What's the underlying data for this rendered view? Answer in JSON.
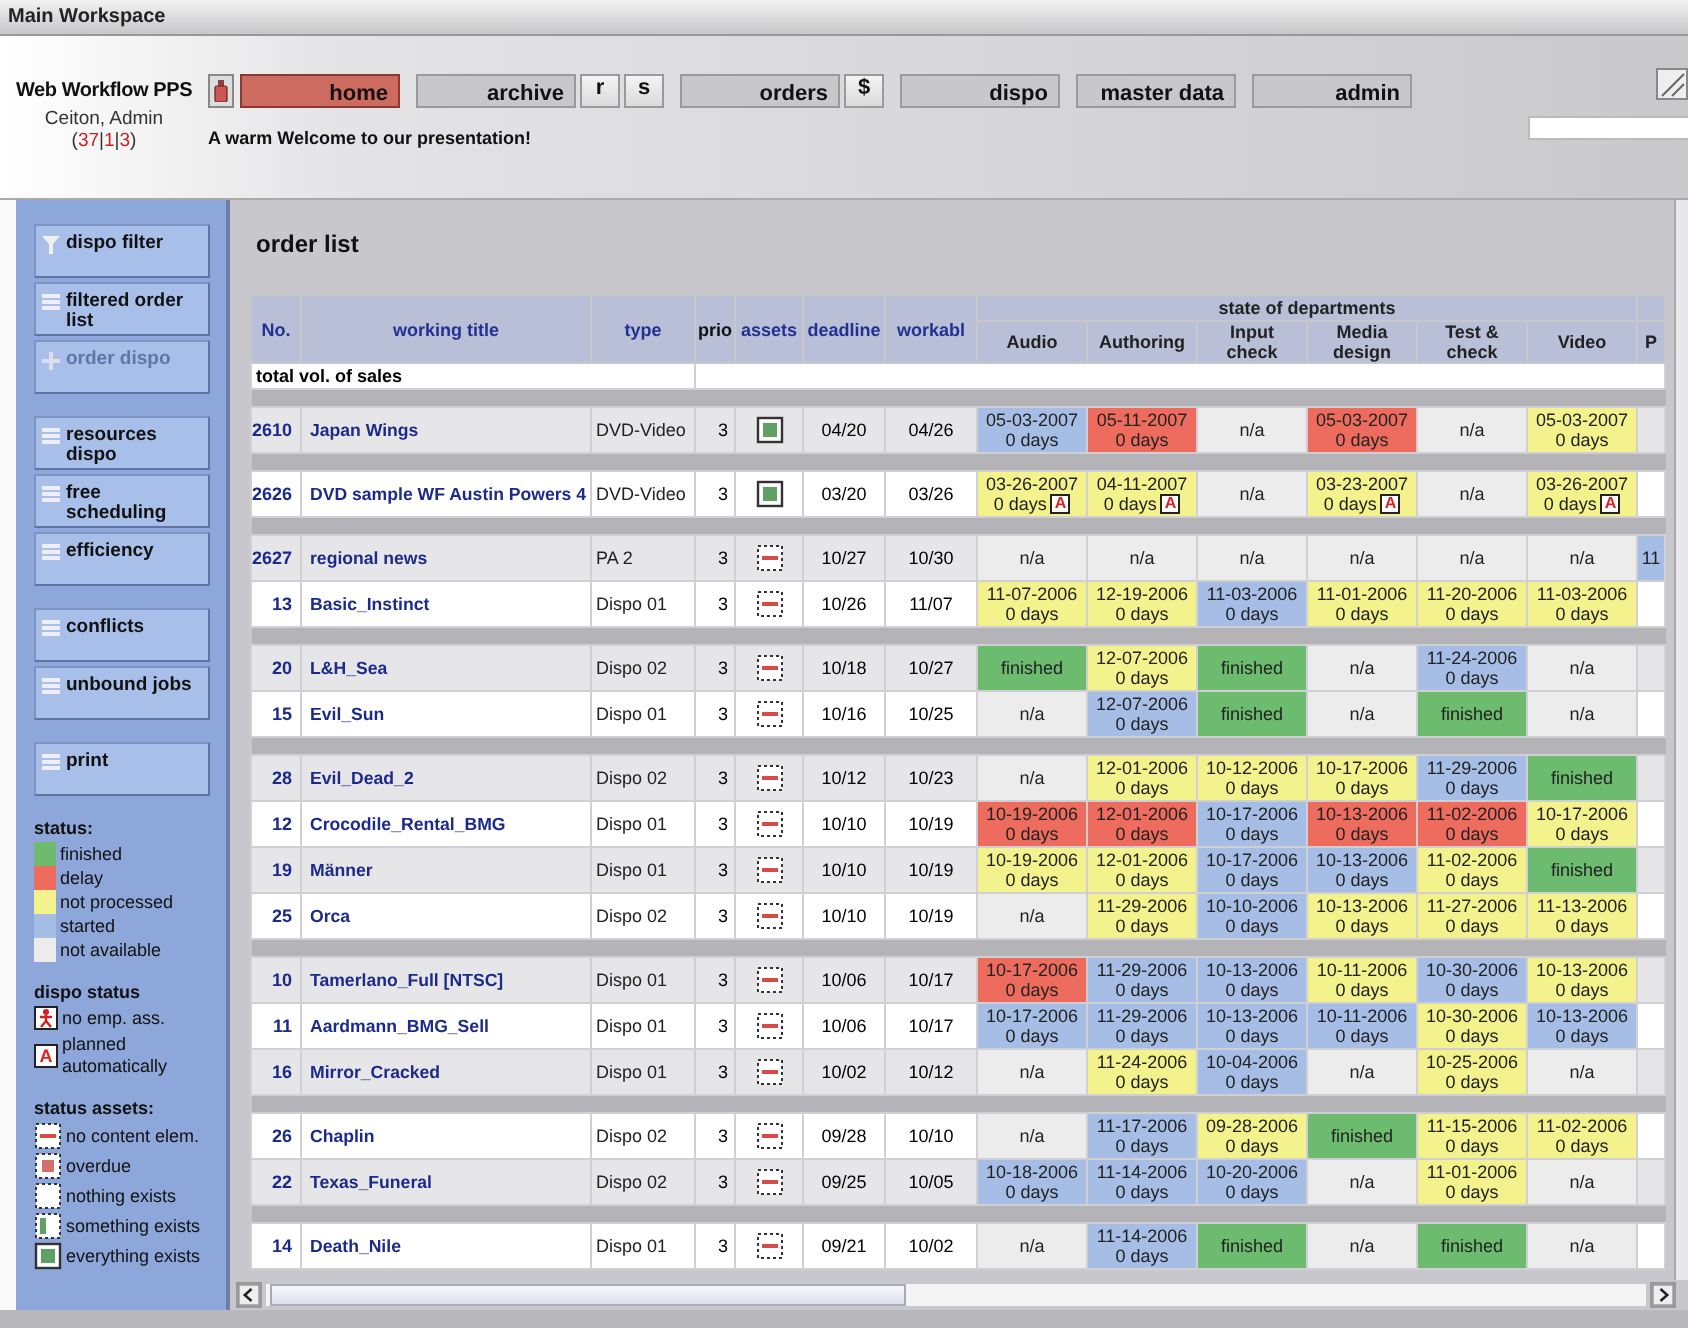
{
  "window": {
    "title": "Main Workspace"
  },
  "header": {
    "app_name": "Web Workflow PPS",
    "user": "Ceiton, Admin",
    "counts": [
      {
        "text": "(",
        "kind": "punct"
      },
      {
        "text": "37",
        "kind": "count"
      },
      {
        "text": "|",
        "kind": "punct"
      },
      {
        "text": "1",
        "kind": "count"
      },
      {
        "text": "|",
        "kind": "punct"
      },
      {
        "text": "3",
        "kind": "count"
      },
      {
        "text": ")",
        "kind": "punct"
      }
    ],
    "welcome": "A warm Welcome to our presentation!"
  },
  "nav": [
    {
      "label": "home",
      "selected": true
    },
    {
      "label": "archive",
      "selected": false,
      "extras": [
        "r",
        "s"
      ]
    },
    {
      "label": "orders",
      "selected": false,
      "extras": [
        "$"
      ]
    },
    {
      "label": "dispo",
      "selected": false
    },
    {
      "label": "master data",
      "selected": false
    },
    {
      "label": "admin",
      "selected": false
    }
  ],
  "sidebar": {
    "groups": [
      [
        {
          "label": "dispo filter",
          "kind": "filter",
          "disabled": false
        },
        {
          "label": "filtered order list",
          "kind": "list",
          "disabled": false
        },
        {
          "label": "order dispo",
          "kind": "plus",
          "disabled": true
        }
      ],
      [
        {
          "label": "resources dispo",
          "kind": "list",
          "disabled": false
        },
        {
          "label": "free scheduling",
          "kind": "list",
          "disabled": false
        },
        {
          "label": "efficiency",
          "kind": "list",
          "disabled": false
        }
      ],
      [
        {
          "label": "conflicts",
          "kind": "list",
          "disabled": false
        },
        {
          "label": "unbound jobs",
          "kind": "list",
          "disabled": false
        }
      ],
      [
        {
          "label": "print",
          "kind": "list",
          "disabled": false
        }
      ]
    ],
    "status_legend": {
      "title": "status:",
      "items": [
        {
          "label": "finished",
          "color": "#6cbb6e"
        },
        {
          "label": "delay",
          "color": "#ee6c5e"
        },
        {
          "label": "not processed",
          "color": "#f3f28c"
        },
        {
          "label": "started",
          "color": "#a6bee6"
        },
        {
          "label": "not available",
          "color": "#ececec"
        }
      ]
    },
    "dispo_legend": {
      "title": "dispo status",
      "items": [
        {
          "label": "no emp. ass.",
          "kind": "no_employee"
        },
        {
          "label": "planned automatically",
          "kind": "auto",
          "badge": "A"
        }
      ]
    },
    "assets_legend": {
      "title": "status assets:",
      "items": [
        {
          "label": "no content elem.",
          "kind": "no_content"
        },
        {
          "label": "overdue",
          "kind": "overdue"
        },
        {
          "label": "nothing exists",
          "kind": "nothing"
        },
        {
          "label": "something exists",
          "kind": "something"
        },
        {
          "label": "everything exists",
          "kind": "everything"
        }
      ]
    }
  },
  "order_list": {
    "title": "order list",
    "columns": [
      "No.",
      "working title",
      "type",
      "prio",
      "assets",
      "deadline",
      "workabl"
    ],
    "departments_title": "state of departments",
    "departments": [
      "Audio",
      "Authoring",
      "Input check",
      "Media design",
      "Test & check",
      "Video",
      "P"
    ],
    "total_label": "total vol. of sales",
    "groups": [
      [
        {
          "no": "2610",
          "title": "Japan Wings",
          "type": "DVD-Video",
          "prio": "3",
          "assets": {
            "kind": "everything"
          },
          "deadline": "04/20",
          "workable": "04/26",
          "cells": [
            {
              "color": "#a6bee6",
              "text": "05-03-2007",
              "days": "0 days"
            },
            {
              "color": "#ee6c5e",
              "text": "05-11-2007",
              "days": "0 days"
            },
            {
              "color": "#ececec",
              "text": "n/a"
            },
            {
              "color": "#ee6c5e",
              "text": "05-03-2007",
              "days": "0 days"
            },
            {
              "color": "#ececec",
              "text": "n/a"
            },
            {
              "color": "#f3f28c",
              "text": "05-03-2007",
              "days": "0 days"
            }
          ]
        }
      ],
      [
        {
          "no": "2626",
          "title": "DVD sample WF Austin Powers 4",
          "type": "DVD-Video",
          "prio": "3",
          "assets": {
            "kind": "everything"
          },
          "deadline": "03/20",
          "workable": "03/26",
          "cells": [
            {
              "color": "#f3f28c",
              "text": "03-26-2007",
              "days": "0 days",
              "badge": "A"
            },
            {
              "color": "#f3f28c",
              "text": "04-11-2007",
              "days": "0 days",
              "badge": "A"
            },
            {
              "color": "#ececec",
              "text": "n/a"
            },
            {
              "color": "#f3f28c",
              "text": "03-23-2007",
              "days": "0 days",
              "badge": "A"
            },
            {
              "color": "#ececec",
              "text": "n/a"
            },
            {
              "color": "#f3f28c",
              "text": "03-26-2007",
              "days": "0 days",
              "badge": "A"
            }
          ]
        }
      ],
      [
        {
          "no": "2627",
          "title": "regional news",
          "type": "PA 2",
          "prio": "3",
          "assets": {
            "kind": "no_content"
          },
          "deadline": "10/27",
          "workable": "10/30",
          "cells": [
            {
              "color": "#ececec",
              "text": "n/a"
            },
            {
              "color": "#ececec",
              "text": "n/a"
            },
            {
              "color": "#ececec",
              "text": "n/a"
            },
            {
              "color": "#ececec",
              "text": "n/a"
            },
            {
              "color": "#ececec",
              "text": "n/a"
            },
            {
              "color": "#ececec",
              "text": "n/a"
            },
            {
              "color": "#a6bee6",
              "text": "11"
            }
          ]
        },
        {
          "no": "13",
          "title": "Basic_Instinct",
          "type": "Dispo 01",
          "prio": "3",
          "assets": {
            "kind": "no_content"
          },
          "deadline": "10/26",
          "workable": "11/07",
          "cells": [
            {
              "color": "#f3f28c",
              "text": "11-07-2006",
              "days": "0 days"
            },
            {
              "color": "#f3f28c",
              "text": "12-19-2006",
              "days": "0 days"
            },
            {
              "color": "#a6bee6",
              "text": "11-03-2006",
              "days": "0 days"
            },
            {
              "color": "#f3f28c",
              "text": "11-01-2006",
              "days": "0 days"
            },
            {
              "color": "#f3f28c",
              "text": "11-20-2006",
              "days": "0 days"
            },
            {
              "color": "#f3f28c",
              "text": "11-03-2006",
              "days": "0 days"
            }
          ]
        }
      ],
      [
        {
          "no": "20",
          "title": "L&H_Sea",
          "type": "Dispo 02",
          "prio": "3",
          "assets": {
            "kind": "no_content"
          },
          "deadline": "10/18",
          "workable": "10/27",
          "cells": [
            {
              "color": "#6cbb6e",
              "text": "finished"
            },
            {
              "color": "#f3f28c",
              "text": "12-07-2006",
              "days": "0 days"
            },
            {
              "color": "#6cbb6e",
              "text": "finished"
            },
            {
              "color": "#ececec",
              "text": "n/a"
            },
            {
              "color": "#a6bee6",
              "text": "11-24-2006",
              "days": "0 days"
            },
            {
              "color": "#ececec",
              "text": "n/a"
            }
          ]
        },
        {
          "no": "15",
          "title": "Evil_Sun",
          "type": "Dispo 01",
          "prio": "3",
          "assets": {
            "kind": "no_content"
          },
          "deadline": "10/16",
          "workable": "10/25",
          "cells": [
            {
              "color": "#ececec",
              "text": "n/a"
            },
            {
              "color": "#a6bee6",
              "text": "12-07-2006",
              "days": "0 days"
            },
            {
              "color": "#6cbb6e",
              "text": "finished"
            },
            {
              "color": "#ececec",
              "text": "n/a"
            },
            {
              "color": "#6cbb6e",
              "text": "finished"
            },
            {
              "color": "#ececec",
              "text": "n/a"
            }
          ]
        }
      ],
      [
        {
          "no": "28",
          "title": "Evil_Dead_2",
          "type": "Dispo 02",
          "prio": "3",
          "assets": {
            "kind": "no_content"
          },
          "deadline": "10/12",
          "workable": "10/23",
          "cells": [
            {
              "color": "#ececec",
              "text": "n/a"
            },
            {
              "color": "#f3f28c",
              "text": "12-01-2006",
              "days": "0 days"
            },
            {
              "color": "#f3f28c",
              "text": "10-12-2006",
              "days": "0 days"
            },
            {
              "color": "#f3f28c",
              "text": "10-17-2006",
              "days": "0 days"
            },
            {
              "color": "#a6bee6",
              "text": "11-29-2006",
              "days": "0 days"
            },
            {
              "color": "#6cbb6e",
              "text": "finished"
            }
          ]
        },
        {
          "no": "12",
          "title": "Crocodile_Rental_BMG",
          "type": "Dispo 01",
          "prio": "3",
          "assets": {
            "kind": "no_content"
          },
          "deadline": "10/10",
          "workable": "10/19",
          "cells": [
            {
              "color": "#ee6c5e",
              "text": "10-19-2006",
              "days": "0 days"
            },
            {
              "color": "#ee6c5e",
              "text": "12-01-2006",
              "days": "0 days"
            },
            {
              "color": "#a6bee6",
              "text": "10-17-2006",
              "days": "0 days"
            },
            {
              "color": "#ee6c5e",
              "text": "10-13-2006",
              "days": "0 days"
            },
            {
              "color": "#ee6c5e",
              "text": "11-02-2006",
              "days": "0 days"
            },
            {
              "color": "#f3f28c",
              "text": "10-17-2006",
              "days": "0 days"
            }
          ]
        },
        {
          "no": "19",
          "title": "Männer",
          "type": "Dispo 01",
          "prio": "3",
          "assets": {
            "kind": "no_content"
          },
          "deadline": "10/10",
          "workable": "10/19",
          "cells": [
            {
              "color": "#f3f28c",
              "text": "10-19-2006",
              "days": "0 days"
            },
            {
              "color": "#f3f28c",
              "text": "12-01-2006",
              "days": "0 days"
            },
            {
              "color": "#a6bee6",
              "text": "10-17-2006",
              "days": "0 days"
            },
            {
              "color": "#a6bee6",
              "text": "10-13-2006",
              "days": "0 days"
            },
            {
              "color": "#f3f28c",
              "text": "11-02-2006",
              "days": "0 days"
            },
            {
              "color": "#6cbb6e",
              "text": "finished"
            }
          ]
        },
        {
          "no": "25",
          "title": "Orca",
          "type": "Dispo 02",
          "prio": "3",
          "assets": {
            "kind": "no_content"
          },
          "deadline": "10/10",
          "workable": "10/19",
          "cells": [
            {
              "color": "#ececec",
              "text": "n/a"
            },
            {
              "color": "#f3f28c",
              "text": "11-29-2006",
              "days": "0 days"
            },
            {
              "color": "#a6bee6",
              "text": "10-10-2006",
              "days": "0 days"
            },
            {
              "color": "#f3f28c",
              "text": "10-13-2006",
              "days": "0 days"
            },
            {
              "color": "#f3f28c",
              "text": "11-27-2006",
              "days": "0 days"
            },
            {
              "color": "#f3f28c",
              "text": "11-13-2006",
              "days": "0 days"
            }
          ]
        }
      ],
      [
        {
          "no": "10",
          "title": "Tamerlano_Full [NTSC]",
          "type": "Dispo 01",
          "prio": "3",
          "assets": {
            "kind": "no_content"
          },
          "deadline": "10/06",
          "workable": "10/17",
          "cells": [
            {
              "color": "#ee6c5e",
              "text": "10-17-2006",
              "days": "0 days"
            },
            {
              "color": "#a6bee6",
              "text": "11-29-2006",
              "days": "0 days"
            },
            {
              "color": "#a6bee6",
              "text": "10-13-2006",
              "days": "0 days"
            },
            {
              "color": "#f3f28c",
              "text": "10-11-2006",
              "days": "0 days"
            },
            {
              "color": "#a6bee6",
              "text": "10-30-2006",
              "days": "0 days"
            },
            {
              "color": "#f3f28c",
              "text": "10-13-2006",
              "days": "0 days"
            }
          ]
        },
        {
          "no": "11",
          "title": "Aardmann_BMG_Sell",
          "type": "Dispo 01",
          "prio": "3",
          "assets": {
            "kind": "no_content"
          },
          "deadline": "10/06",
          "workable": "10/17",
          "cells": [
            {
              "color": "#a6bee6",
              "text": "10-17-2006",
              "days": "0 days"
            },
            {
              "color": "#a6bee6",
              "text": "11-29-2006",
              "days": "0 days"
            },
            {
              "color": "#a6bee6",
              "text": "10-13-2006",
              "days": "0 days"
            },
            {
              "color": "#a6bee6",
              "text": "10-11-2006",
              "days": "0 days"
            },
            {
              "color": "#f3f28c",
              "text": "10-30-2006",
              "days": "0 days"
            },
            {
              "color": "#a6bee6",
              "text": "10-13-2006",
              "days": "0 days"
            }
          ]
        },
        {
          "no": "16",
          "title": "Mirror_Cracked",
          "type": "Dispo 01",
          "prio": "3",
          "assets": {
            "kind": "no_content"
          },
          "deadline": "10/02",
          "workable": "10/12",
          "cells": [
            {
              "color": "#ececec",
              "text": "n/a"
            },
            {
              "color": "#f3f28c",
              "text": "11-24-2006",
              "days": "0 days"
            },
            {
              "color": "#a6bee6",
              "text": "10-04-2006",
              "days": "0 days"
            },
            {
              "color": "#ececec",
              "text": "n/a"
            },
            {
              "color": "#f3f28c",
              "text": "10-25-2006",
              "days": "0 days"
            },
            {
              "color": "#ececec",
              "text": "n/a"
            }
          ]
        }
      ],
      [
        {
          "no": "26",
          "title": "Chaplin",
          "type": "Dispo 02",
          "prio": "3",
          "assets": {
            "kind": "no_content"
          },
          "deadline": "09/28",
          "workable": "10/10",
          "cells": [
            {
              "color": "#ececec",
              "text": "n/a"
            },
            {
              "color": "#a6bee6",
              "text": "11-17-2006",
              "days": "0 days"
            },
            {
              "color": "#f3f28c",
              "text": "09-28-2006",
              "days": "0 days"
            },
            {
              "color": "#6cbb6e",
              "text": "finished"
            },
            {
              "color": "#f3f28c",
              "text": "11-15-2006",
              "days": "0 days"
            },
            {
              "color": "#f3f28c",
              "text": "11-02-2006",
              "days": "0 days"
            }
          ]
        },
        {
          "no": "22",
          "title": "Texas_Funeral",
          "type": "Dispo 02",
          "prio": "3",
          "assets": {
            "kind": "no_content"
          },
          "deadline": "09/25",
          "workable": "10/05",
          "cells": [
            {
              "color": "#a6bee6",
              "text": "10-18-2006",
              "days": "0 days"
            },
            {
              "color": "#a6bee6",
              "text": "11-14-2006",
              "days": "0 days"
            },
            {
              "color": "#a6bee6",
              "text": "10-20-2006",
              "days": "0 days"
            },
            {
              "color": "#ececec",
              "text": "n/a"
            },
            {
              "color": "#f3f28c",
              "text": "11-01-2006",
              "days": "0 days"
            },
            {
              "color": "#ececec",
              "text": "n/a"
            }
          ]
        }
      ],
      [
        {
          "no": "14",
          "title": "Death_Nile",
          "type": "Dispo 01",
          "prio": "3",
          "assets": {
            "kind": "no_content"
          },
          "deadline": "09/21",
          "workable": "10/02",
          "cells": [
            {
              "color": "#ececec",
              "text": "n/a"
            },
            {
              "color": "#a6bee6",
              "text": "11-14-2006",
              "days": "0 days"
            },
            {
              "color": "#6cbb6e",
              "text": "finished"
            },
            {
              "color": "#ececec",
              "text": "n/a"
            },
            {
              "color": "#6cbb6e",
              "text": "finished"
            },
            {
              "color": "#ececec",
              "text": "n/a"
            }
          ]
        }
      ]
    ]
  }
}
